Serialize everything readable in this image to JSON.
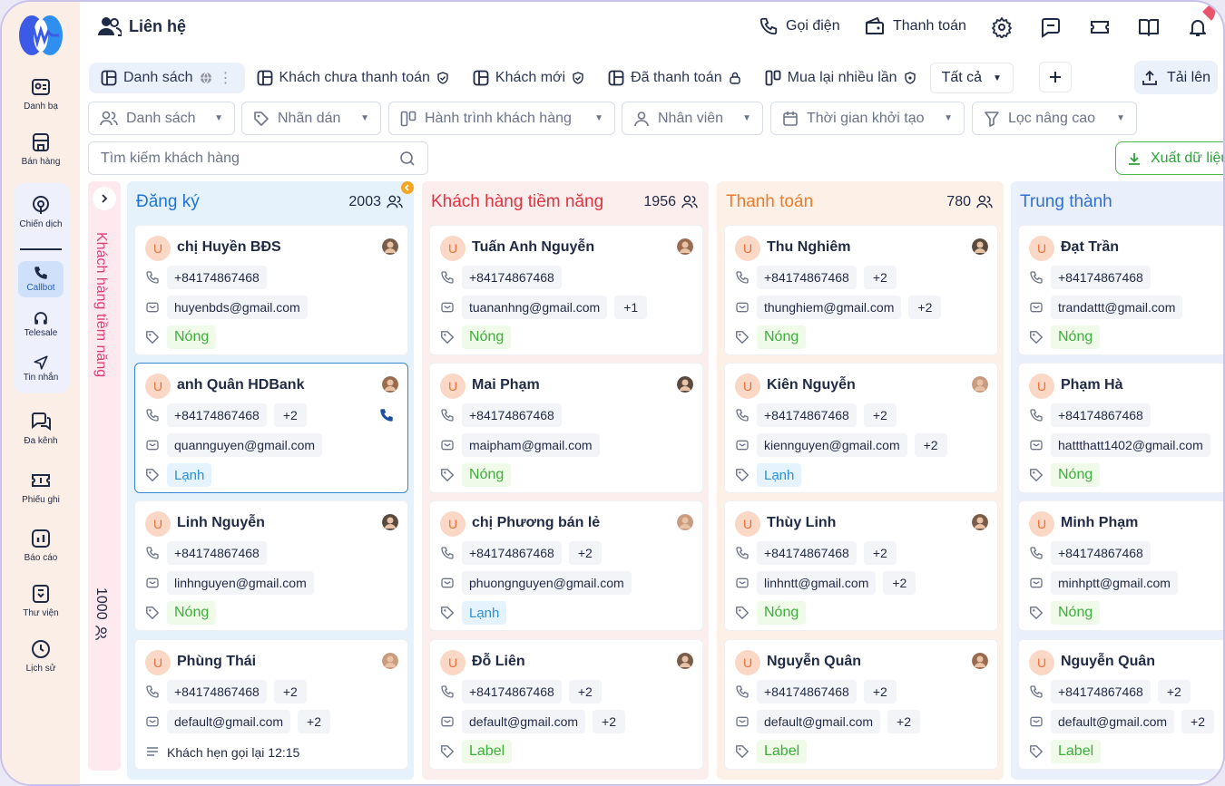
{
  "sidebar": {
    "items": [
      {
        "label": "Danh bạ",
        "icon": "contacts-icon"
      },
      {
        "label": "Bán hàng",
        "icon": "store-icon"
      },
      {
        "label": "Chiến dịch",
        "icon": "campaign-icon"
      },
      {
        "label": "Callbot",
        "icon": "callbot-icon"
      },
      {
        "label": "Telesale",
        "icon": "headset-icon"
      },
      {
        "label": "Tin nhắn",
        "icon": "send-icon"
      },
      {
        "label": "Đa kênh",
        "icon": "chat-icon"
      },
      {
        "label": "Phiếu ghi",
        "icon": "ticket-icon"
      },
      {
        "label": "Báo cáo",
        "icon": "report-icon"
      },
      {
        "label": "Thư viện",
        "icon": "library-icon"
      },
      {
        "label": "Lịch sử",
        "icon": "history-icon"
      }
    ]
  },
  "header": {
    "title": "Liên hệ",
    "call_label": "Gọi điện",
    "payment_label": "Thanh toán"
  },
  "tabs": [
    {
      "label": "Danh sách"
    },
    {
      "label": "Khách chưa thanh toán"
    },
    {
      "label": "Khách mới"
    },
    {
      "label": "Đã thanh toán"
    },
    {
      "label": "Mua lại nhiều lần"
    }
  ],
  "tab_all_label": "Tất cả",
  "upload_label": "Tải lên",
  "filters": [
    {
      "label": "Danh sách"
    },
    {
      "label": "Nhãn dán"
    },
    {
      "label": "Hành trình khách hàng"
    },
    {
      "label": "Nhân viên"
    },
    {
      "label": "Thời gian khởi tạo"
    },
    {
      "label": "Lọc nâng cao"
    }
  ],
  "search": {
    "placeholder": "Tìm kiếm khách hàng"
  },
  "export_label": "Xuất dữ liệu",
  "collapsed_column": {
    "title": "Khách hàng tiềm năng",
    "count": "1000"
  },
  "columns": [
    {
      "title": "Đăng ký",
      "count": "2003",
      "color": "#1e74d6",
      "cards": [
        {
          "name": "chị Huyền BĐS",
          "phone": "+84174867468",
          "phone_extra": "",
          "email": "huyenbds@gmail.com",
          "email_extra": "",
          "tag": "Nóng",
          "tag_type": "hot"
        },
        {
          "name": "anh Quân HDBank",
          "phone": "+84174867468",
          "phone_extra": "+2",
          "email": "quannguyen@gmail.com",
          "email_extra": "",
          "tag": "Lạnh",
          "tag_type": "cold"
        },
        {
          "name": "Linh Nguyễn",
          "phone": "+84174867468",
          "phone_extra": "",
          "email": "linhnguyen@gmail.com",
          "email_extra": "",
          "tag": "Nóng",
          "tag_type": "hot"
        },
        {
          "name": "Phùng Thái",
          "phone": "+84174867468",
          "phone_extra": "+2",
          "email": "default@gmail.com",
          "email_extra": "+2",
          "note": "Khách hẹn gọi lại 12:15"
        }
      ]
    },
    {
      "title": "Khách hàng tiềm năng",
      "count": "1956",
      "color": "#e0323f",
      "cards": [
        {
          "name": "Tuấn Anh Nguyễn",
          "phone": "+84174867468",
          "phone_extra": "",
          "email": "tuananhng@gmail.com",
          "email_extra": "+1",
          "tag": "Nóng",
          "tag_type": "hot"
        },
        {
          "name": "Mai Phạm",
          "phone": "+84174867468",
          "phone_extra": "",
          "email": "maipham@gmail.com",
          "email_extra": "",
          "tag": "Nóng",
          "tag_type": "hot"
        },
        {
          "name": "chị Phương bán lẻ",
          "phone": "+84174867468",
          "phone_extra": "+2",
          "email": "phuongnguyen@gmail.com",
          "email_extra": "",
          "tag": "Lạnh",
          "tag_type": "cold"
        },
        {
          "name": "Đỗ Liên",
          "phone": "+84174867468",
          "phone_extra": "+2",
          "email": "default@gmail.com",
          "email_extra": "+2",
          "tag": "Label",
          "tag_type": "label"
        }
      ]
    },
    {
      "title": "Thanh toán",
      "count": "780",
      "color": "#ee7b2a",
      "cards": [
        {
          "name": "Thu Nghiêm",
          "phone": "+84174867468",
          "phone_extra": "+2",
          "email": "thunghiem@gmail.com",
          "email_extra": "+2",
          "tag": "Nóng",
          "tag_type": "hot"
        },
        {
          "name": "Kiên Nguyễn",
          "phone": "+84174867468",
          "phone_extra": "+2",
          "email": "kiennguyen@gmail.com",
          "email_extra": "+2",
          "tag": "Lạnh",
          "tag_type": "cold"
        },
        {
          "name": "Thùy Linh",
          "phone": "+84174867468",
          "phone_extra": "+2",
          "email": "linhntt@gmail.com",
          "email_extra": "+2",
          "tag": "Nóng",
          "tag_type": "hot"
        },
        {
          "name": "Nguyễn Quân",
          "phone": "+84174867468",
          "phone_extra": "+2",
          "email": "default@gmail.com",
          "email_extra": "+2",
          "tag": "Label",
          "tag_type": "label"
        }
      ]
    },
    {
      "title": "Trung thành",
      "count": "",
      "color": "#2f6fd6",
      "cards": [
        {
          "name": "Đạt Trần",
          "phone": "+84174867468",
          "phone_extra": "",
          "email": "trandattt@gmail.com",
          "email_extra": "",
          "tag": "Nóng",
          "tag_type": "hot"
        },
        {
          "name": "Phạm Hà",
          "phone": "+84174867468",
          "phone_extra": "",
          "email": "hattthatt1402@gmail.com",
          "email_extra": "",
          "tag": "Nóng",
          "tag_type": "hot"
        },
        {
          "name": "Minh Phạm",
          "phone": "+84174867468",
          "phone_extra": "",
          "email": "minhptt@gmail.com",
          "email_extra": "",
          "tag": "Nóng",
          "tag_type": "hot"
        },
        {
          "name": "Nguyễn Quân",
          "phone": "+84174867468",
          "phone_extra": "+2",
          "email": "default@gmail.com",
          "email_extra": "+2",
          "tag": "Label",
          "tag_type": "label"
        }
      ]
    }
  ],
  "avatar_letter": "U"
}
